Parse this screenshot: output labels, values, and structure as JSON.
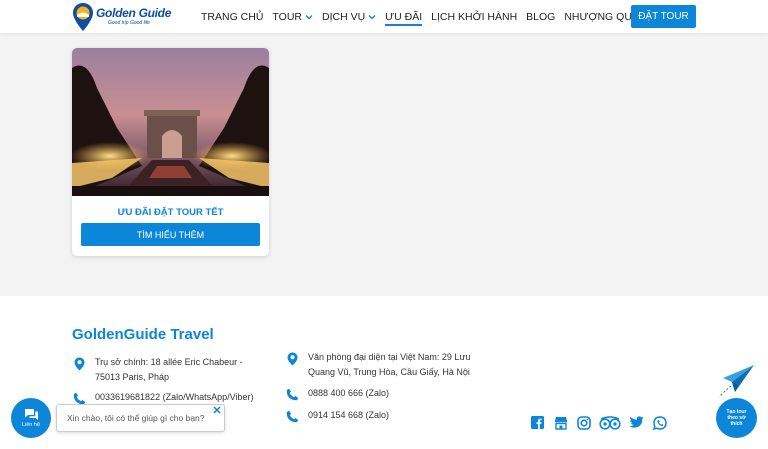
{
  "header": {
    "logo": {
      "name": "Golden Guide",
      "tagline": "Good trip Good life"
    },
    "nav": [
      {
        "label": "TRANG CHỦ",
        "dropdown": false,
        "active": false
      },
      {
        "label": "TOUR",
        "dropdown": true,
        "active": false
      },
      {
        "label": "DỊCH VỤ",
        "dropdown": true,
        "active": false
      },
      {
        "label": "ƯU ĐÃI",
        "dropdown": false,
        "active": true
      },
      {
        "label": "LỊCH KHỞI HÀNH",
        "dropdown": false,
        "active": false
      },
      {
        "label": "BLOG",
        "dropdown": false,
        "active": false
      },
      {
        "label": "NHƯỢNG QUYỀN",
        "dropdown": false,
        "active": false
      }
    ],
    "cta_label": "ĐẶT TOUR"
  },
  "card": {
    "title": "ƯU ĐÃI ĐẶT TOUR TẾT",
    "button_label": "TÌM HIỂU THÊM"
  },
  "footer": {
    "brand": "GoldenGuide Travel",
    "left": {
      "address": "Trụ sở chính: 18 allée Eric Chabeur - 75013 Paris, Pháp",
      "phone": "0033619681822 (Zalo/WhatsApp/Viber)"
    },
    "right": {
      "address": "Văn phòng đại diện tại Việt Nam: 29 Lưu Quang Vũ, Trung Hòa, Cầu Giấy, Hà Nội",
      "phone1": "0888 400 666 (Zalo)",
      "phone2": "0914 154 668 (Zalo)"
    },
    "socials": [
      "facebook-icon",
      "store-icon",
      "instagram-icon",
      "tripadvisor-icon",
      "twitter-icon",
      "whatsapp-icon"
    ]
  },
  "widgets": {
    "chat_label": "Liên hệ",
    "chat_message": "Xin chào, tôi có thể giúp gì cho bạn?",
    "tour_label_1": "Tạo tour",
    "tour_label_2": "theo sở",
    "tour_label_3": "thích"
  },
  "colors": {
    "primary": "#0b86d8",
    "logo": "#0d4fa3"
  }
}
